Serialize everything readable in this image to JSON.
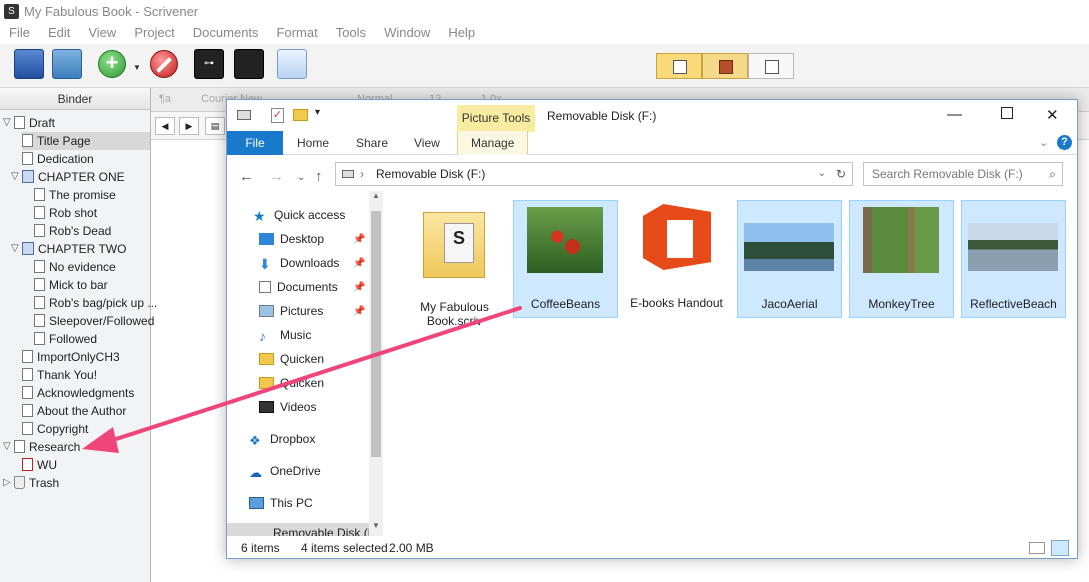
{
  "window": {
    "title": "My Fabulous Book - Scrivener"
  },
  "menu": [
    "File",
    "Edit",
    "View",
    "Project",
    "Documents",
    "Format",
    "Tools",
    "Window",
    "Help"
  ],
  "binder": {
    "header": "Binder",
    "items": [
      {
        "label": "Draft"
      },
      {
        "label": "Title Page"
      },
      {
        "label": "Dedication"
      },
      {
        "label": "CHAPTER ONE"
      },
      {
        "label": "The promise"
      },
      {
        "label": "Rob shot"
      },
      {
        "label": "Rob's Dead"
      },
      {
        "label": "CHAPTER TWO"
      },
      {
        "label": "No evidence"
      },
      {
        "label": "Mick to bar"
      },
      {
        "label": "Rob's bag/pick up ..."
      },
      {
        "label": "Sleepover/Followed"
      },
      {
        "label": "Followed"
      },
      {
        "label": "ImportOnlyCH3"
      },
      {
        "label": "Thank You!"
      },
      {
        "label": "Acknowledgments"
      },
      {
        "label": "About the Author"
      },
      {
        "label": "Copyright"
      },
      {
        "label": "Research"
      },
      {
        "label": "WU"
      },
      {
        "label": "Trash"
      }
    ]
  },
  "format_bar": {
    "style": "¶a",
    "font": "Courier New",
    "weight": "Normal",
    "size": "12",
    "spacing": "1.0x"
  },
  "explorer": {
    "context_tab": "Picture Tools",
    "title": "Removable Disk (F:)",
    "tabs": {
      "file": "File",
      "home": "Home",
      "share": "Share",
      "view": "View",
      "manage": "Manage"
    },
    "address": "Removable Disk (F:)",
    "search_placeholder": "Search Removable Disk (F:)",
    "nav": [
      {
        "label": "Quick access"
      },
      {
        "label": "Desktop"
      },
      {
        "label": "Downloads"
      },
      {
        "label": "Documents"
      },
      {
        "label": "Pictures"
      },
      {
        "label": "Music"
      },
      {
        "label": "Quicken"
      },
      {
        "label": "Quicken"
      },
      {
        "label": "Videos"
      },
      {
        "label": "Dropbox"
      },
      {
        "label": "OneDrive"
      },
      {
        "label": "This PC"
      },
      {
        "label": "Removable Disk (F"
      }
    ],
    "files": [
      {
        "name": "My Fabulous Book.scriv"
      },
      {
        "name": "CoffeeBeans"
      },
      {
        "name": "E-books Handout"
      },
      {
        "name": "JacoAerial"
      },
      {
        "name": "MonkeyTree"
      },
      {
        "name": "ReflectiveBeach"
      }
    ],
    "status": {
      "count": "6 items",
      "selected": "4 items selected",
      "size": "2.00 MB"
    }
  },
  "colors": {
    "accent": "#1979ca",
    "arrow": "#f0457a",
    "selection": "#cde8ff",
    "office": "#e64a19"
  }
}
